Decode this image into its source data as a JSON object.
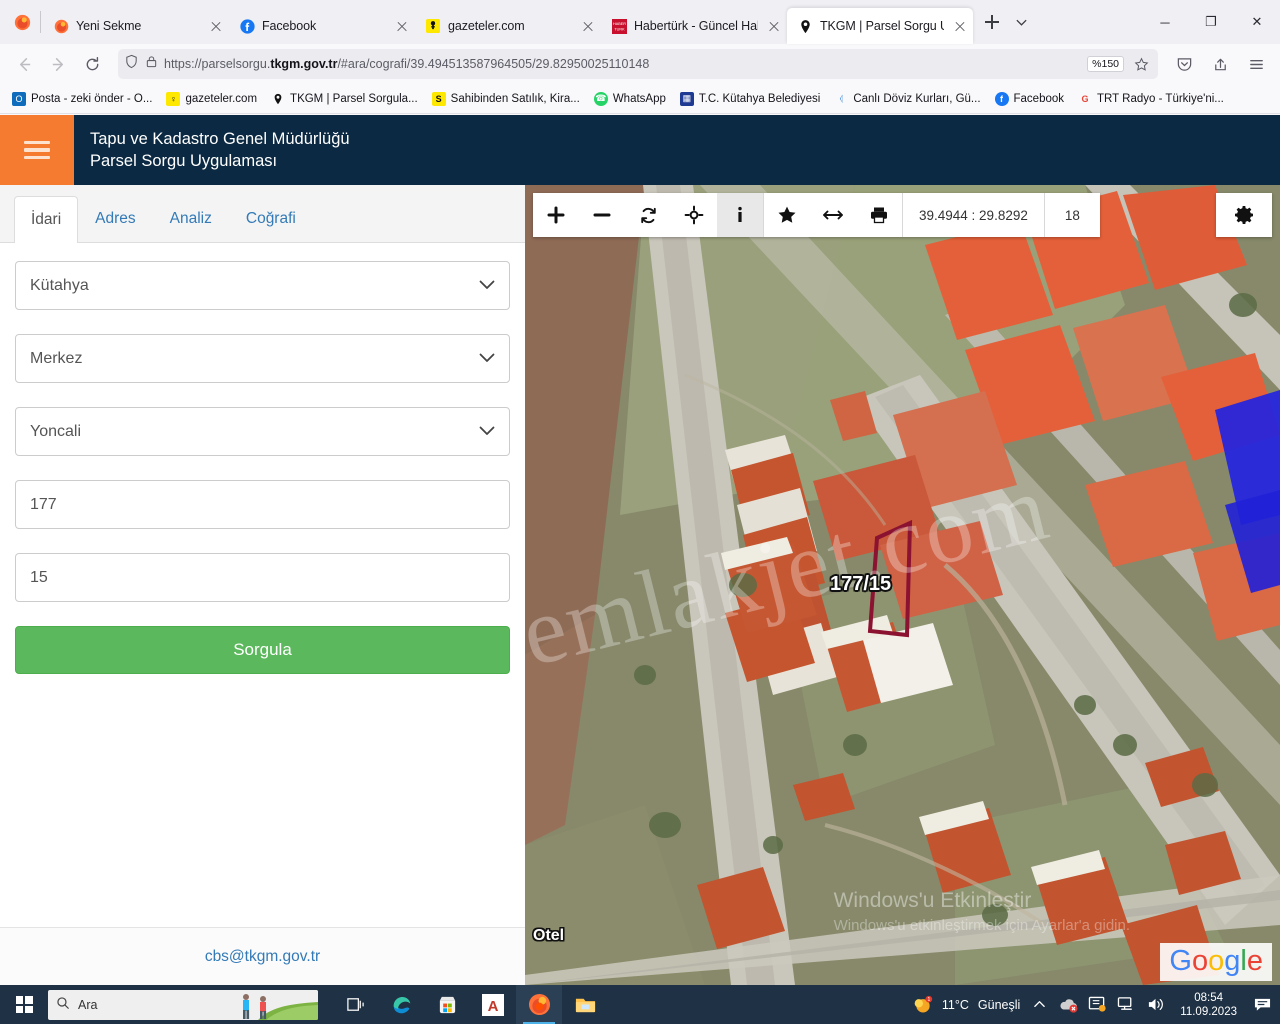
{
  "browser": {
    "tabs": [
      {
        "title": "Yeni Sekme",
        "icon": "firefox-icon",
        "active": false
      },
      {
        "title": "Facebook",
        "icon": "facebook-icon",
        "active": false
      },
      {
        "title": "gazeteler.com",
        "icon": "pin-icon",
        "active": false
      },
      {
        "title": "Habertürk - Güncel Haber",
        "icon": "haberturk-icon",
        "active": false
      },
      {
        "title": "TKGM | Parsel Sorgu Uygu",
        "icon": "pin-icon",
        "active": true
      }
    ],
    "url": "https://parselsorgu.tkgm.gov.tr/#ara/cografi/39.494513587964505/29.82950025110148",
    "url_host": "tkgm.gov.tr",
    "url_prefix": "https://parselsorgu.",
    "url_suffix": "/#ara/cografi/39.494513587964505/29.82950025110148",
    "zoom_badge": "%150",
    "bookmarks": [
      {
        "label": "Posta - zeki önder - O...",
        "icon": "outlook-icon",
        "color": "#0f6cbd",
        "glyph": "O"
      },
      {
        "label": "gazeteler.com",
        "icon": "pin-icon",
        "color": "#f4c430",
        "glyph": "♀"
      },
      {
        "label": "TKGM | Parsel Sorgula...",
        "icon": "pin-icon",
        "color": "#111111",
        "glyph": "●"
      },
      {
        "label": "Sahibinden Satılık, Kira...",
        "icon": "sahibinden-icon",
        "color": "#ffe800",
        "glyph": "S"
      },
      {
        "label": "WhatsApp",
        "icon": "whatsapp-icon",
        "color": "#25d366",
        "glyph": "✆"
      },
      {
        "label": "T.C. Kütahya Belediyesi",
        "icon": "belediye-icon",
        "color": "#1f3a93",
        "glyph": "▦"
      },
      {
        "label": "Canlı Döviz Kurları, Gü...",
        "icon": "doviz-icon",
        "color": "#4a90d9",
        "glyph": "⚉"
      },
      {
        "label": "Facebook",
        "icon": "facebook-icon",
        "color": "#1877f2",
        "glyph": "f"
      },
      {
        "label": "TRT Radyo - Türkiye'ni...",
        "icon": "google-icon",
        "color": "#ea4335",
        "glyph": "G"
      }
    ],
    "window_controls": {
      "minimize": "─",
      "maximize": "❐",
      "close": "✕"
    }
  },
  "app": {
    "header": {
      "line1": "Tapu ve Kadastro Genel Müdürlüğü",
      "line2": "Parsel Sorgu Uygulaması",
      "menu_icon": "hamburger-icon",
      "bg_color": "#0b2942",
      "accent_color": "#f47b30"
    },
    "tabs": [
      {
        "label": "İdari",
        "active": true
      },
      {
        "label": "Adres",
        "active": false
      },
      {
        "label": "Analiz",
        "active": false
      },
      {
        "label": "Coğrafi",
        "active": false
      }
    ],
    "form": {
      "il": {
        "value": "Kütahya",
        "type": "select"
      },
      "ilce": {
        "value": "Merkez",
        "type": "select"
      },
      "mahalle": {
        "value": "Yoncali",
        "type": "select"
      },
      "ada": {
        "value": "177",
        "type": "text"
      },
      "parsel": {
        "value": "15",
        "type": "text"
      },
      "submit_label": "Sorgula",
      "submit_color": "#5cb85c"
    },
    "footer": {
      "email": "cbs@tkgm.gov.tr"
    }
  },
  "map": {
    "toolbar": {
      "buttons": [
        {
          "name": "zoom-in",
          "glyph": "+",
          "active": false
        },
        {
          "name": "zoom-out",
          "glyph": "−",
          "active": false
        },
        {
          "name": "refresh",
          "glyph": "↻",
          "active": false
        },
        {
          "name": "locate",
          "glyph": "⌖",
          "active": false
        },
        {
          "name": "info",
          "glyph": "i",
          "active": true
        },
        {
          "name": "favorite",
          "glyph": "★",
          "active": false
        },
        {
          "name": "measure",
          "glyph": "↔",
          "active": false
        },
        {
          "name": "print",
          "glyph": "⎙",
          "active": false
        }
      ],
      "coordinates": "39.4944 : 29.8292",
      "zoom_level": "18"
    },
    "settings_icon": "gear-icon",
    "parcel_label": "177/15",
    "poi_label": "Otel",
    "watermark_emlak": "emlakjet.com",
    "windows_activate_line1": "Windows'u Etkinleştir",
    "windows_activate_line2": "Windows'u etkinleştirmek için Ayarlar'a gidin.",
    "attribution": "Google",
    "parcel_outline_color": "#8b1230"
  },
  "taskbar": {
    "search_placeholder": "Ara",
    "search_icon": "search-icon",
    "start_icon": "windows-icon",
    "items": [
      {
        "name": "task-view-icon",
        "glyph": "⧉"
      },
      {
        "name": "edge-icon",
        "glyph": "e"
      },
      {
        "name": "microsoft-store-icon",
        "glyph": "⊞"
      },
      {
        "name": "autocad-icon",
        "glyph": "A"
      },
      {
        "name": "firefox-icon",
        "glyph": "◕",
        "active": true
      },
      {
        "name": "file-explorer-icon",
        "glyph": "☰"
      }
    ],
    "weather": {
      "temp": "11°C",
      "condition": "Güneşli"
    },
    "clock": {
      "time": "08:54",
      "date": "11.09.2023"
    },
    "tray": [
      {
        "name": "show-hidden-icons",
        "glyph": "∧"
      },
      {
        "name": "onedrive-error-icon",
        "glyph": "☁"
      },
      {
        "name": "screen-icon",
        "glyph": "▣"
      },
      {
        "name": "network-icon",
        "glyph": "❖"
      },
      {
        "name": "volume-icon",
        "glyph": "ᴘ"
      },
      {
        "name": "notifications-icon",
        "glyph": "✉"
      }
    ]
  }
}
